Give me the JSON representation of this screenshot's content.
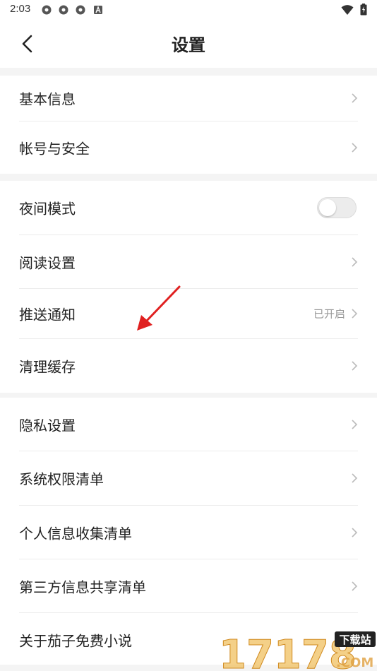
{
  "status": {
    "time": "2:03",
    "left_icons": [
      "app-notification-icon",
      "app-notification-icon",
      "app-notification-icon",
      "a-badge-icon"
    ],
    "right_icons": [
      "wifi-icon",
      "battery-icon"
    ]
  },
  "header": {
    "title": "设置",
    "back_icon": "chevron-left-icon"
  },
  "groups": [
    {
      "items": [
        {
          "label": "基本信息",
          "type": "link"
        },
        {
          "label": "帐号与安全",
          "type": "link"
        }
      ]
    },
    {
      "items": [
        {
          "label": "夜间模式",
          "type": "toggle",
          "on": false
        },
        {
          "label": "阅读设置",
          "type": "link"
        },
        {
          "label": "推送通知",
          "type": "link",
          "value": "已开启"
        },
        {
          "label": "清理缓存",
          "type": "link"
        }
      ]
    },
    {
      "items": [
        {
          "label": "隐私设置",
          "type": "link"
        },
        {
          "label": "系统权限清单",
          "type": "link"
        },
        {
          "label": "个人信息收集清单",
          "type": "link"
        },
        {
          "label": "第三方信息共享清单",
          "type": "link"
        },
        {
          "label": "关于茄子免费小说",
          "type": "link"
        }
      ]
    }
  ],
  "annotation": {
    "icon": "red-arrow-icon",
    "color": "#e02020"
  },
  "watermark": {
    "text_main": "17178",
    "text_badge": "下载站",
    "text_sub": ".COM"
  },
  "colors": {
    "background": "#f4f4f4",
    "surface": "#ffffff",
    "text": "#222222",
    "muted": "#999999",
    "divider": "#ececec"
  }
}
